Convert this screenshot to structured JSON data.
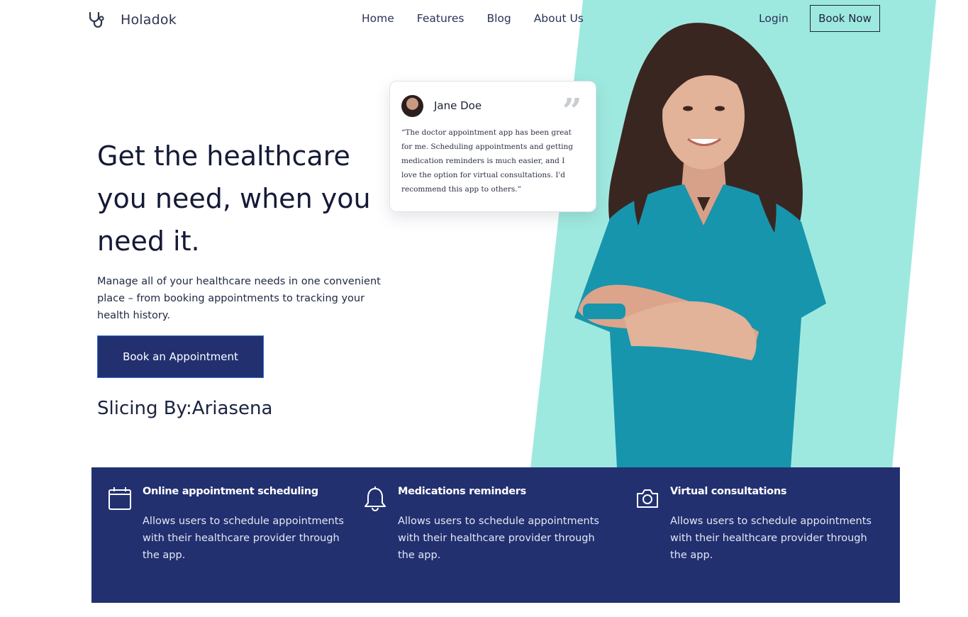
{
  "header": {
    "brand": "Holadok",
    "nav": [
      "Home",
      "Features",
      "Blog",
      "About Us"
    ],
    "login": "Login",
    "book_now": "Book Now"
  },
  "hero": {
    "title": "Get the healthcare you need, when you need it.",
    "description": "Manage all of your healthcare needs in one convenient place – from booking appointments to tracking your health history.",
    "cta": "Book an Appointment",
    "credit": "Slicing By:Ariasena"
  },
  "testimonial": {
    "name": "Jane Doe",
    "quote_mark": "”",
    "text": "“The doctor appointment app has been great for me. Scheduling appointments and getting medication reminders is much easier, and I love the option for virtual consultations. I'd recommend this app to others.”"
  },
  "features": [
    {
      "icon": "calendar-icon",
      "title": "Online appointment scheduling",
      "description": "Allows users to schedule appointments with their healthcare provider through the app."
    },
    {
      "icon": "bell-icon",
      "title": "Medications reminders",
      "description": "Allows users to schedule appointments with their healthcare provider through the app."
    },
    {
      "icon": "camera-icon",
      "title": "Virtual consultations",
      "description": "Allows users to schedule appointments with their healthcare provider through the app."
    }
  ],
  "colors": {
    "navy": "#223070",
    "teal_panel": "#9ee9df",
    "scrubs": "#1795ad",
    "text_dark": "#141a36"
  }
}
